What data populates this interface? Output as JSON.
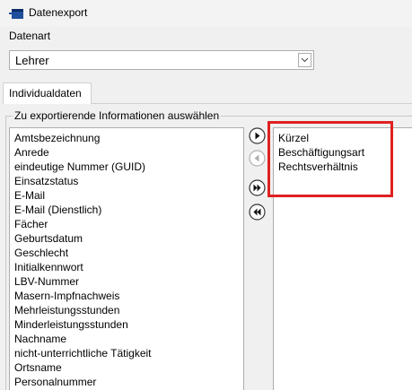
{
  "window": {
    "title": "Datenexport"
  },
  "datenart": {
    "label": "Datenart",
    "selected": "Lehrer"
  },
  "tabs": [
    {
      "label": "Individualdaten"
    }
  ],
  "group": {
    "title": "Zu exportierende Informationen auswählen"
  },
  "available": [
    "Amtsbezeichnung",
    "Anrede",
    "eindeutige Nummer (GUID)",
    "Einsatzstatus",
    "E-Mail",
    "E-Mail (Dienstlich)",
    "Fächer",
    "Geburtsdatum",
    "Geschlecht",
    "Initialkennwort",
    "LBV-Nummer",
    "Masern-Impfnachweis",
    "Mehrleistungsstunden",
    "Minderleistungsstunden",
    "Nachname",
    "nicht-unterrichtliche Tätigkeit",
    "Ortsname",
    "Personalnummer"
  ],
  "selected_fields": [
    "Kürzel",
    "Beschäftigungsart",
    "Rechtsverhältnis"
  ],
  "buttons": {
    "add_one": "arrow-right-icon",
    "remove_one": "arrow-left-icon",
    "add_all": "double-arrow-right-icon",
    "remove_all": "double-arrow-left-icon"
  },
  "colors": {
    "highlight": "#e02020",
    "disabled": "#b0b0b0"
  }
}
